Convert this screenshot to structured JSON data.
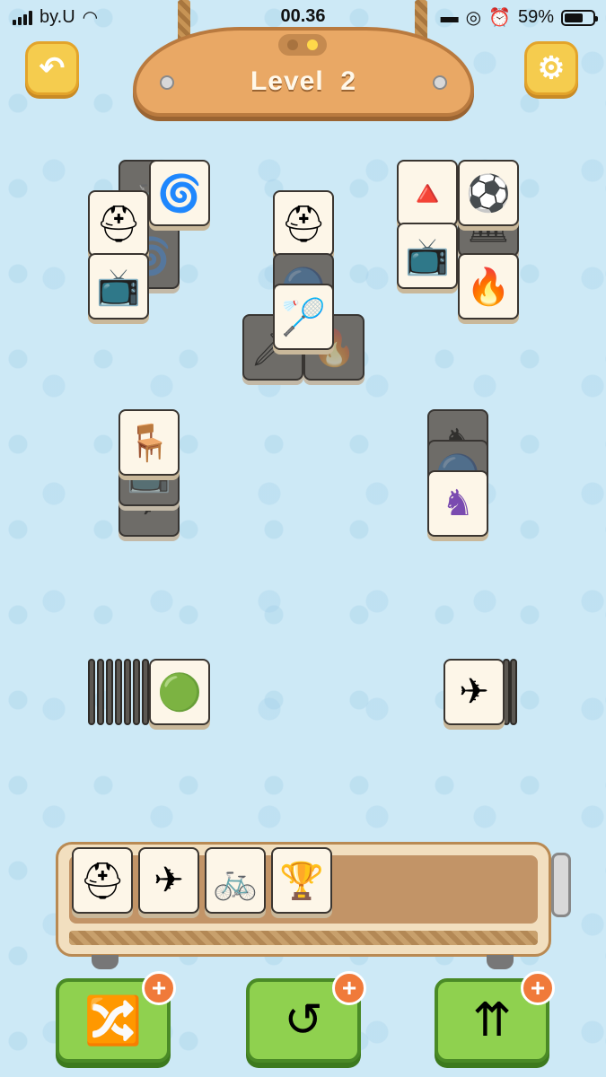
{
  "status_bar": {
    "carrier": "by.U",
    "time": "00.36",
    "battery": "59%"
  },
  "header": {
    "level_label": "Level",
    "level_number": "2",
    "back_icon": "back-arrow-icon",
    "settings_icon": "gear-icon"
  },
  "board": {
    "top_left": [
      "spinning-top",
      "helmet",
      "spinning-top",
      "tv"
    ],
    "top_center": [
      "helmet",
      "marble",
      "shuttlecock",
      "nutcracker",
      "torch"
    ],
    "top_right": [
      "cone-hat",
      "soccer-ball",
      "tv",
      "torch",
      "cone-hat"
    ],
    "mid_left": [
      "bench",
      "tv",
      "airplane"
    ],
    "mid_right": [
      "chess-knight",
      "marble",
      "chess-knight"
    ],
    "bottom_left_top": "marble",
    "bottom_right_top": "airplane"
  },
  "tray": {
    "slots": [
      "helmet",
      "airplane",
      "bicycle",
      "trophy"
    ],
    "capacity": 7
  },
  "powerups": [
    {
      "name": "shuffle",
      "icon": "shuffle-icon"
    },
    {
      "name": "undo",
      "icon": "undo-icon"
    },
    {
      "name": "hint",
      "icon": "hint-arrows-icon"
    }
  ],
  "colors": {
    "background": "#cde9f6",
    "tile": "#fdf6e8",
    "button_green": "#8fd14f",
    "button_yellow": "#f5cc4e",
    "plus_badge": "#f07a3a"
  }
}
